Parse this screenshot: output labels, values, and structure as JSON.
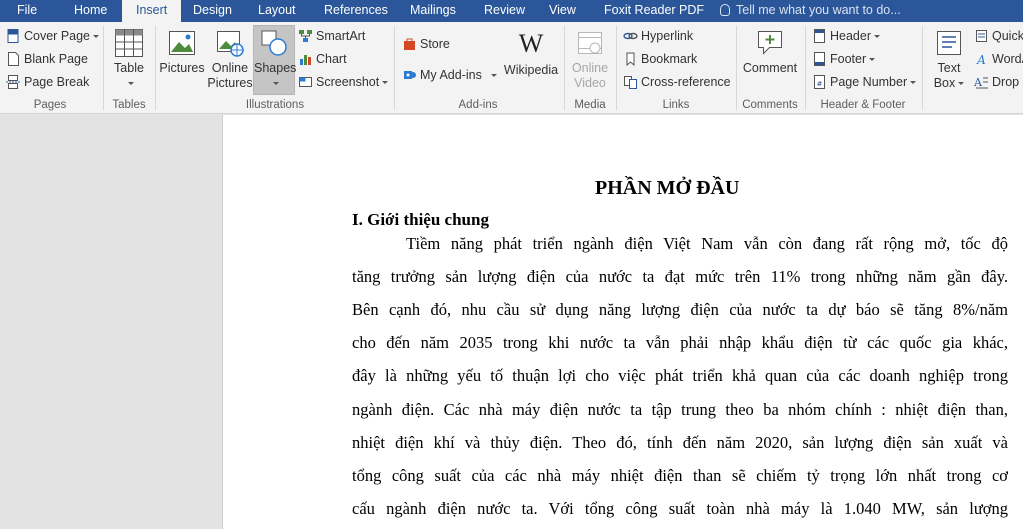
{
  "tabs": [
    {
      "label": "File",
      "active": false
    },
    {
      "label": "Home",
      "active": false
    },
    {
      "label": "Insert",
      "active": true
    },
    {
      "label": "Design",
      "active": false
    },
    {
      "label": "Layout",
      "active": false
    },
    {
      "label": "References",
      "active": false
    },
    {
      "label": "Mailings",
      "active": false
    },
    {
      "label": "Review",
      "active": false
    },
    {
      "label": "View",
      "active": false
    },
    {
      "label": "Foxit Reader PDF",
      "active": false
    }
  ],
  "tell_me": "Tell me what you want to do...",
  "ribbon": {
    "pages": {
      "label": "Pages",
      "cover_page": "Cover Page",
      "blank_page": "Blank Page",
      "page_break": "Page Break"
    },
    "tables": {
      "label": "Tables",
      "table": "Table"
    },
    "illustrations": {
      "label": "Illustrations",
      "pictures": "Pictures",
      "online_pictures_1": "Online",
      "online_pictures_2": "Pictures",
      "shapes": "Shapes",
      "smartart": "SmartArt",
      "chart": "Chart",
      "screenshot": "Screenshot"
    },
    "addins": {
      "label": "Add-ins",
      "store": "Store",
      "my_addins": "My Add-ins",
      "wikipedia": "Wikipedia"
    },
    "media": {
      "label": "Media",
      "online_video_1": "Online",
      "online_video_2": "Video"
    },
    "links": {
      "label": "Links",
      "hyperlink": "Hyperlink",
      "bookmark": "Bookmark",
      "cross_reference": "Cross-reference"
    },
    "comments": {
      "label": "Comments",
      "comment": "Comment"
    },
    "header_footer": {
      "label": "Header & Footer",
      "header": "Header",
      "footer": "Footer",
      "page_number": "Page Number"
    },
    "text": {
      "text_box_1": "Text",
      "text_box_2": "Box",
      "quick": "Quick",
      "wordart": "WordA",
      "drop": "Drop"
    }
  },
  "colors": {
    "accent": "#2b579a",
    "ribbon_bg": "#f3f3f3",
    "canvas_bg": "#e3e3e3"
  },
  "document": {
    "title": "PHẦN MỞ ĐẦU",
    "heading": "I. Giới thiệu chung",
    "lines": [
      "Tiềm năng phát triển ngành điện Việt Nam vẫn còn đang rất rộng mở, tốc độ",
      "tăng trưởng sản lượng điện của nước ta đạt mức trên 11% trong những năm gần đây.",
      "Bên cạnh đó, nhu cầu sử dụng năng lượng điện của nước ta dự báo sẽ tăng 8%/năm",
      "cho đến năm 2035 trong khi nước ta vẫn phải nhập khẩu điện từ các quốc gia khác,",
      "đây là những yếu tố thuận lợi cho việc phát triển khả quan của các doanh nghiệp trong",
      "ngành điện. Các nhà máy điện nước ta tập trung theo ba nhóm chính : nhiệt điện than,",
      "nhiệt điện khí và thủy điện. Theo đó, tính đến năm 2020, sản lượng điện sản xuất và",
      "tổng công suất của các nhà máy nhiệt điện than sẽ chiếm tỷ trọng lớn nhất trong cơ",
      "cấu ngành điện nước ta. Với tổng công suất toàn nhà máy là 1.040 MW, sản lượng"
    ]
  }
}
